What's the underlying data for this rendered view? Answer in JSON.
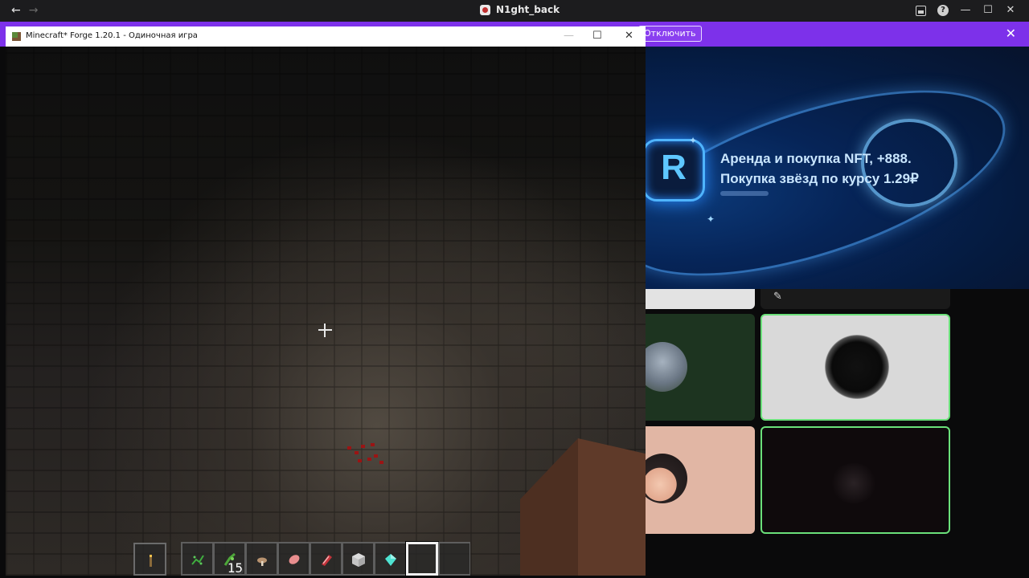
{
  "host_window": {
    "title": "N1ght_back",
    "nav": {
      "back": "←",
      "forward": "→"
    },
    "controls": {
      "minimize": "—",
      "maximize": "☐",
      "close": "✕",
      "help": "?"
    }
  },
  "stream_banner": {
    "disable_label": "Отключить",
    "close": "✕",
    "accent_color": "#7d31ea"
  },
  "minecraft_window": {
    "title": "Minecraft* Forge 1.20.1 - Одиночная игра",
    "controls": {
      "minimize": "—",
      "maximize": "☐",
      "close": "✕"
    },
    "hotbar": {
      "offhand_item": "torch-icon",
      "slots": [
        {
          "item": "vine-icon",
          "count": ""
        },
        {
          "item": "glow-berries-icon",
          "count": "15"
        },
        {
          "item": "mushroom-icon",
          "count": ""
        },
        {
          "item": "raw-pork-icon",
          "count": ""
        },
        {
          "item": "raw-beef-icon",
          "count": ""
        },
        {
          "item": "iron-block-icon",
          "count": ""
        },
        {
          "item": "diamond-icon",
          "count": ""
        },
        {
          "item": "",
          "count": ""
        },
        {
          "item": "",
          "count": ""
        }
      ],
      "selected_slot": 8
    }
  },
  "ad": {
    "line1": "Аренда и покупка NFT, +888.",
    "line2": "Покупка звёзд по курсу 1.29₽",
    "logo_letter": "R"
  },
  "gallery": {
    "active_border_color": "#6be07a",
    "muted_icon": "muted-mic-icon"
  }
}
